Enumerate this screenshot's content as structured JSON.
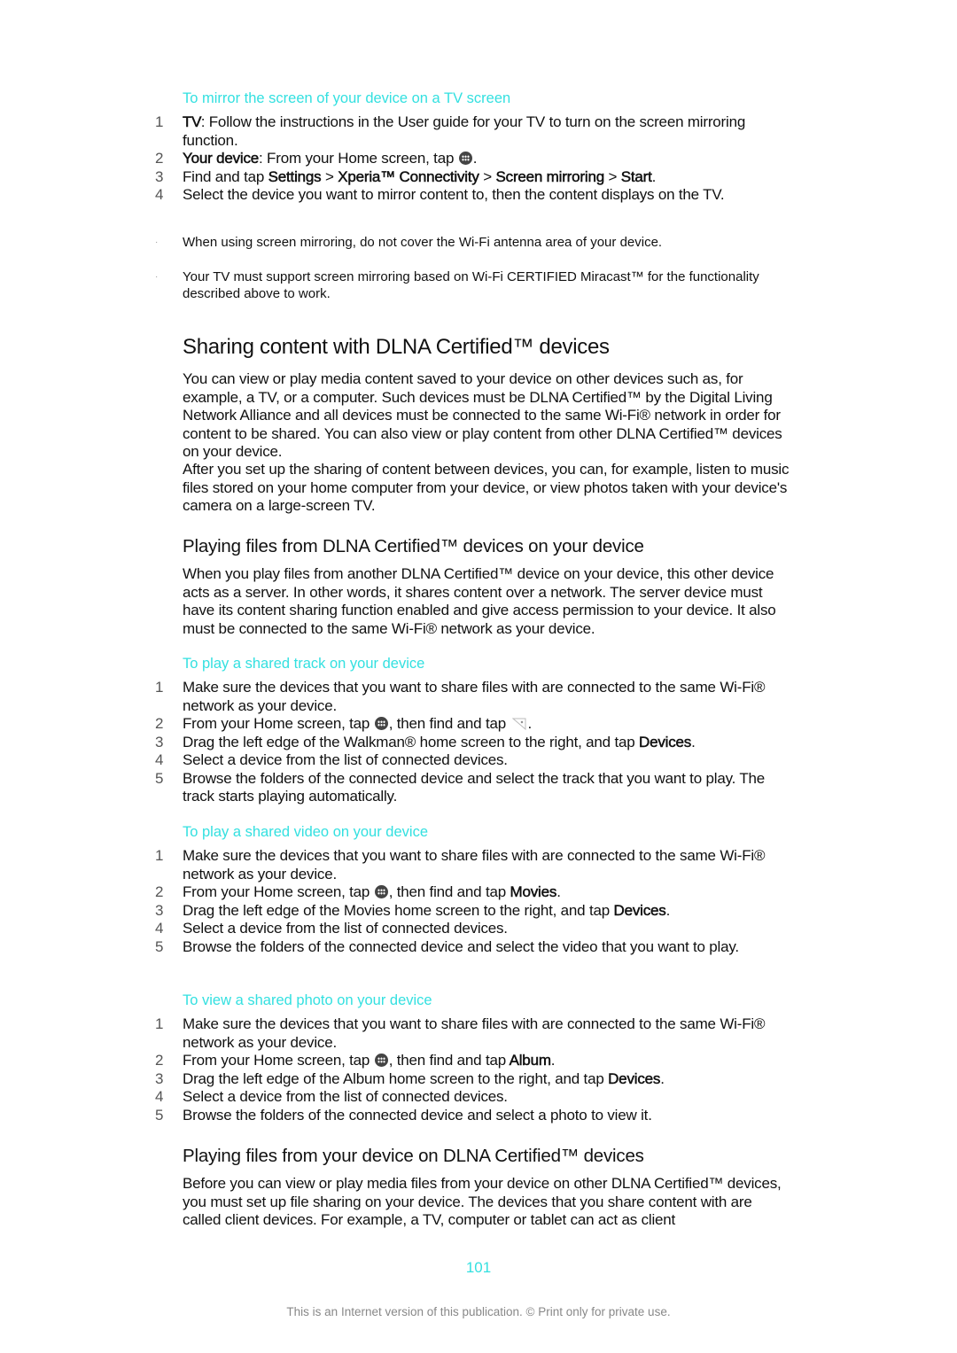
{
  "mirror": {
    "heading": "To mirror the screen of your device on a TV screen",
    "steps": [
      {
        "num": "1",
        "label": "TV",
        "text": ": Follow the instructions in the User guide for your TV to turn on the screen mirroring function."
      },
      {
        "num": "2",
        "label": "Your device",
        "text": ": From your Home screen, tap ",
        "icon": "apps-icon",
        "end": "."
      },
      {
        "num": "3",
        "pre": "Find and tap ",
        "b1": "Settings",
        "s1": " > ",
        "b2": "Xperia™ Connectivity",
        "s2": " > ",
        "b3": "Screen mirroring",
        "s3": " > ",
        "b4": "Start",
        "end": "."
      },
      {
        "num": "4",
        "text": "Select the device you want to mirror content to, then the content displays on the TV."
      }
    ],
    "notes": [
      "When using screen mirroring, do not cover the Wi-Fi antenna area of your device.",
      "Your TV must support screen mirroring based on Wi-Fi CERTIFIED Miracast™ for the functionality described above to work."
    ]
  },
  "section": {
    "title": "Sharing content with DLNA Certified™ devices",
    "para1": "You can view or play media content saved to your device on other devices such as, for example, a TV, or a computer. Such devices must be DLNA Certified™ by the Digital Living Network Alliance and all devices must be connected to the same Wi-Fi® network in order for content to be shared. You can also view or play content from other DLNA Certified™ devices on your device.",
    "para2": "After you set up the sharing of content between devices, you can, for example, listen to music files stored on your home computer from your device, or view photos taken with your device's camera on a large-screen TV."
  },
  "playing_from": {
    "title": "Playing files from DLNA Certified™ devices on your device",
    "para": "When you play files from another DLNA Certified™ device on your device, this other device acts as a server. In other words, it shares content over a network. The server device must have its content sharing function enabled and give access permission to your device. It also must be connected to the same Wi-Fi® network as your device."
  },
  "track": {
    "heading": "To play a shared track on your device",
    "s1": "Make sure the devices that you want to share files with are connected to the same Wi-Fi® network as your device.",
    "s2a": "From your Home screen, tap ",
    "s2b": ", then find and tap ",
    "s2c": ".",
    "s3a": "Drag the left edge of the Walkman® home screen to the right, and tap ",
    "s3b": "Devices",
    "s3c": ".",
    "s4": "Select a device from the list of connected devices.",
    "s5": "Browse the folders of the connected device and select the track that you want to play. The track starts playing automatically."
  },
  "video": {
    "heading": "To play a shared video on your device",
    "s1": "Make sure the devices that you want to share files with are connected to the same Wi-Fi® network as your device.",
    "s2a": "From your Home screen, tap ",
    "s2b": ", then find and tap ",
    "s2bold": "Movies",
    "s2c": ".",
    "s3a": "Drag the left edge of the Movies home screen to the right, and tap ",
    "s3b": "Devices",
    "s3c": ".",
    "s4": "Select a device from the list of connected devices.",
    "s5": "Browse the folders of the connected device and select the video that you want to play."
  },
  "photo": {
    "heading": "To view a shared photo on your device",
    "s1": "Make sure the devices that you want to share files with are connected to the same Wi-Fi® network as your device.",
    "s2a": "From your Home screen, tap ",
    "s2b": ", then find and tap ",
    "s2bold": "Album",
    "s2c": ".",
    "s3a": "Drag the left edge of the Album home screen to the right, and tap ",
    "s3b": "Devices",
    "s3c": ".",
    "s4": "Select a device from the list of connected devices.",
    "s5": "Browse the folders of the connected device and select a photo to view it."
  },
  "playing_to": {
    "title": "Playing files from your device on DLNA Certified™ devices",
    "para": "Before you can view or play media files from your device on other DLNA Certified™ devices, you must set up file sharing on your device. The devices that you share content with are called client devices. For example, a TV, computer or tablet can act as client"
  },
  "page_number": "101",
  "footer": "This is an Internet version of this publication. © Print only for private use.",
  "nums": [
    "1",
    "2",
    "3",
    "4",
    "5"
  ]
}
